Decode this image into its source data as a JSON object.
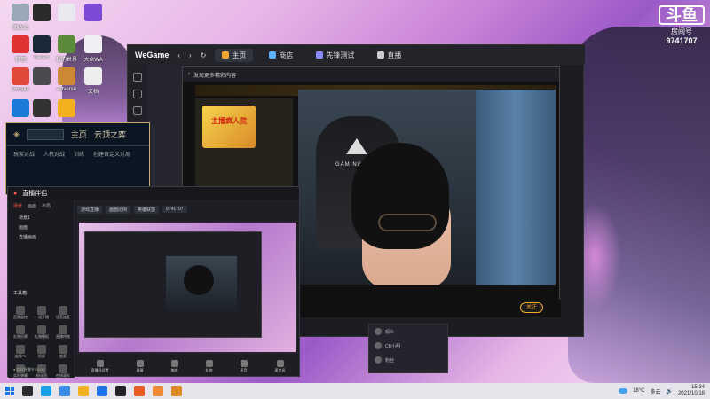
{
  "desktop": {
    "icons": [
      {
        "label": "回收站",
        "color": "#9aa9b8",
        "name": "recycle-bin-icon"
      },
      {
        "label": "",
        "color": "#2a2a2a",
        "name": "app-icon"
      },
      {
        "label": "",
        "color": "#e8e8ee",
        "name": "document-icon"
      },
      {
        "label": "",
        "color": "#7b4bd6",
        "name": "w-app-icon"
      },
      {
        "label": "管理",
        "color": "#d33",
        "name": "admin-icon"
      },
      {
        "label": "Steam",
        "color": "#1b2838",
        "name": "steam-icon"
      },
      {
        "label": "我的世界",
        "color": "#5a8a3a",
        "name": "minecraft-icon"
      },
      {
        "label": "大众WA",
        "color": "#f0f0f4",
        "name": "document-icon"
      },
      {
        "label": "Google",
        "color": "#e04a3a",
        "name": "chrome-icon"
      },
      {
        "label": "",
        "color": "#4a4a50",
        "name": "user-icon"
      },
      {
        "label": "Adverse",
        "color": "#c83",
        "name": "game-icon"
      },
      {
        "label": "文档",
        "color": "#eee",
        "name": "document-icon"
      },
      {
        "label": "",
        "color": "#1a7ad8",
        "name": "edge-icon"
      },
      {
        "label": "",
        "color": "#333",
        "name": "app-icon"
      },
      {
        "label": "",
        "color": "#f2b01e",
        "name": "app-icon"
      }
    ]
  },
  "room_badge": {
    "label": "房间号",
    "number": "9741707"
  },
  "wegame": {
    "brand": "WeGame",
    "tabs": [
      {
        "label": "主页",
        "color": "#f0a830"
      },
      {
        "label": "商店",
        "color": "#5ab0ff"
      },
      {
        "label": "先锋测试",
        "color": "#8a8aff"
      },
      {
        "label": "直播",
        "color": "#ccc"
      }
    ],
    "stream_title": "发现更多精彩内容",
    "follow_label": "关注",
    "thumb_text": "主播疯人院"
  },
  "lol": {
    "nav": [
      "主页",
      "云顶之弈"
    ],
    "sub": [
      "玩家对战",
      "人机对战",
      "训练",
      "创建自定义对局"
    ]
  },
  "stapp": {
    "title": "直播伴侣",
    "tabs": [
      "场景",
      "画面",
      "布局"
    ],
    "scenes": [
      "场景1",
      "画面",
      "直播画面"
    ],
    "toolbox_label": "工具箱",
    "tools": [
      "直播监控",
      "一键开播",
      "语音连麦",
      "礼物投票",
      "礼物播报",
      "直播特效",
      "连线PK",
      "投屏",
      "抽奖",
      "实时弹幕",
      "粉丝团",
      "在线观众"
    ],
    "chips": [
      "游戏直播",
      "画面比例",
      "英雄联盟",
      "9741707"
    ],
    "bottom": [
      "直播间设置",
      "屏幕",
      "美颜",
      "礼物",
      "声音",
      "麦克风"
    ],
    "status": "● 实时直播中 00:00"
  },
  "chat": {
    "rows": [
      "观众",
      "CB小明",
      "粉丝"
    ]
  },
  "taskbar": {
    "apps": [
      "#2a2a2a",
      "#1aa0e8",
      "#3a8ae8",
      "#f2b01e",
      "#1a73e8",
      "#222",
      "#e85a20",
      "#f08a30",
      "#d82"
    ],
    "weather": "18°C",
    "weather_desc": "多云",
    "time": "15:34",
    "date": "2021/10/18"
  }
}
